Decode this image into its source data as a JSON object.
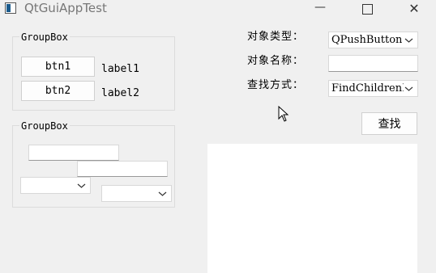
{
  "window": {
    "title": "QtGuiAppTest"
  },
  "groupbox1": {
    "title": "GroupBox",
    "btn1": "btn1",
    "label1": "label1",
    "btn2": "btn2",
    "label2": "label2"
  },
  "groupbox2": {
    "title": "GroupBox"
  },
  "search": {
    "type_label": "对象类型：",
    "type_value": "QPushButton",
    "name_label": "对象名称：",
    "name_value": "",
    "method_label": "查找方式：",
    "method_value": "FindChildrenRecursively",
    "find_button": "查找"
  },
  "icons": {
    "app": "qt-app-icon",
    "minimize": "minimize-icon",
    "maximize": "maximize-icon",
    "close": "close-icon",
    "chevron": "chevron-down-icon",
    "cursor": "mouse-cursor-icon"
  }
}
